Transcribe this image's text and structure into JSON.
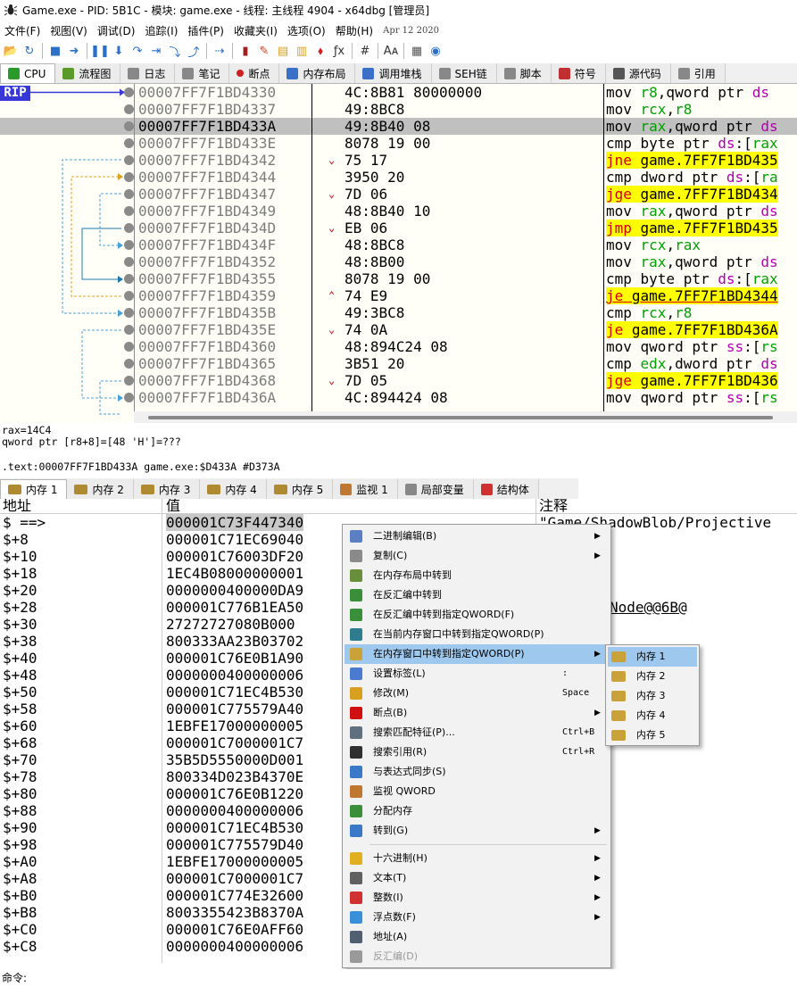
{
  "window": {
    "title": "Game.exe - PID: 5B1C - 模块: game.exe - 线程: 主线程 4904 - x64dbg [管理员]"
  },
  "menu": {
    "items": [
      "文件(F)",
      "视图(V)",
      "调试(D)",
      "追踪(I)",
      "插件(P)",
      "收藏夹(I)",
      "选项(O)",
      "帮助(H)"
    ],
    "date": "Apr 12 2020"
  },
  "toolbar": {
    "icons": [
      "open-icon",
      "restart-icon",
      "stop-icon",
      "run-icon",
      "pause-icon",
      "step-into-icon",
      "step-over-icon",
      "trace-into-icon",
      "trace-over-icon",
      "execute-till-return-icon",
      "run-to-user-code-icon",
      "script-icon",
      "patch-icon",
      "comment-icon",
      "label-icon",
      "bookmark-icon",
      "function-icon",
      "hash-icon",
      "font-icon",
      "calculator-icon",
      "globe-icon"
    ]
  },
  "main_tabs": [
    "CPU",
    "流程图",
    "日志",
    "笔记",
    "断点",
    "内存布局",
    "调用堆栈",
    "SEH链",
    "脚本",
    "符号",
    "源代码",
    "引用"
  ],
  "disasm": {
    "rip_label": "RIP",
    "rows": [
      {
        "addr": "00007FF7F1BD4330",
        "mark": "",
        "bytes": "4C:8B81 80000000",
        "ins": [
          {
            "t": "mov ",
            "c": ""
          },
          {
            "t": "r8",
            "c": "rg"
          },
          {
            "t": ",qword ptr ",
            "c": ""
          },
          {
            "t": "ds",
            "c": "seg"
          }
        ]
      },
      {
        "addr": "00007FF7F1BD4337",
        "mark": "",
        "bytes": "49:8BC8",
        "ins": [
          {
            "t": "mov ",
            "c": ""
          },
          {
            "t": "rcx",
            "c": "rg"
          },
          {
            "t": ",",
            "c": ""
          },
          {
            "t": "r8",
            "c": "rg"
          }
        ]
      },
      {
        "addr": "00007FF7F1BD433A",
        "mark": "",
        "bytes": "49:8B40 08",
        "ins": [
          {
            "t": "mov ",
            "c": ""
          },
          {
            "t": "rax",
            "c": "rg"
          },
          {
            "t": ",qword ptr ",
            "c": ""
          },
          {
            "t": "ds",
            "c": "seg"
          }
        ],
        "selected": true
      },
      {
        "addr": "00007FF7F1BD433E",
        "mark": "",
        "bytes": "8078 19 00",
        "ins": [
          {
            "t": "cmp ",
            "c": ""
          },
          {
            "t": "byte ptr ",
            "c": ""
          },
          {
            "t": "ds",
            "c": "seg"
          },
          {
            "t": ":[",
            "c": ""
          },
          {
            "t": "rax",
            "c": "rg"
          }
        ]
      },
      {
        "addr": "00007FF7F1BD4342",
        "mark": "⌄",
        "bytes": "75 17",
        "ins": [
          {
            "t": "jne",
            "c": "kw-j hl"
          },
          {
            "t": " game.7FF7F1BD435",
            "c": "hl"
          }
        ]
      },
      {
        "addr": "00007FF7F1BD4344",
        "mark": "",
        "bytes": "3950 20",
        "ins": [
          {
            "t": "cmp ",
            "c": ""
          },
          {
            "t": "dword ptr ",
            "c": ""
          },
          {
            "t": "ds",
            "c": "seg"
          },
          {
            "t": ":[",
            "c": ""
          },
          {
            "t": "ra",
            "c": "rg"
          }
        ]
      },
      {
        "addr": "00007FF7F1BD4347",
        "mark": "⌄",
        "bytes": "7D 06",
        "ins": [
          {
            "t": "jge",
            "c": "kw-j hl"
          },
          {
            "t": " game.7FF7F1BD434",
            "c": "hl"
          }
        ]
      },
      {
        "addr": "00007FF7F1BD4349",
        "mark": "",
        "bytes": "48:8B40 10",
        "ins": [
          {
            "t": "mov ",
            "c": ""
          },
          {
            "t": "rax",
            "c": "rg"
          },
          {
            "t": ",qword ptr ",
            "c": ""
          },
          {
            "t": "ds",
            "c": "seg"
          }
        ]
      },
      {
        "addr": "00007FF7F1BD434D",
        "mark": "⌄",
        "bytes": "EB 06",
        "ins": [
          {
            "t": "jmp",
            "c": "kw-j hl"
          },
          {
            "t": " game.7FF7F1BD435",
            "c": "hl"
          }
        ]
      },
      {
        "addr": "00007FF7F1BD434F",
        "mark": "",
        "bytes": "48:8BC8",
        "ins": [
          {
            "t": "mov ",
            "c": ""
          },
          {
            "t": "rcx",
            "c": "rg"
          },
          {
            "t": ",",
            "c": ""
          },
          {
            "t": "rax",
            "c": "rg"
          }
        ]
      },
      {
        "addr": "00007FF7F1BD4352",
        "mark": "",
        "bytes": "48:8B00",
        "ins": [
          {
            "t": "mov ",
            "c": ""
          },
          {
            "t": "rax",
            "c": "rg"
          },
          {
            "t": ",qword ptr ",
            "c": ""
          },
          {
            "t": "ds",
            "c": "seg"
          }
        ]
      },
      {
        "addr": "00007FF7F1BD4355",
        "mark": "",
        "bytes": "8078 19 00",
        "ins": [
          {
            "t": "cmp ",
            "c": ""
          },
          {
            "t": "byte ptr ",
            "c": ""
          },
          {
            "t": "ds",
            "c": "seg"
          },
          {
            "t": ":[",
            "c": ""
          },
          {
            "t": "rax",
            "c": "rg"
          }
        ]
      },
      {
        "addr": "00007FF7F1BD4359",
        "mark": "⌃",
        "bytes": "74 E9",
        "ins": [
          {
            "t": "je",
            "c": "kw-j hl"
          },
          {
            "t": " game.7FF7F1BD4344",
            "c": "hl"
          }
        ]
      },
      {
        "addr": "00007FF7F1BD435B",
        "mark": "",
        "bytes": "49:3BC8",
        "ins": [
          {
            "t": "cmp ",
            "c": ""
          },
          {
            "t": "rcx",
            "c": "rg"
          },
          {
            "t": ",",
            "c": ""
          },
          {
            "t": "r8",
            "c": "rg"
          }
        ]
      },
      {
        "addr": "00007FF7F1BD435E",
        "mark": "⌄",
        "bytes": "74 0A",
        "ins": [
          {
            "t": "je",
            "c": "kw-j hl"
          },
          {
            "t": " game.7FF7F1BD436A",
            "c": "hl"
          }
        ]
      },
      {
        "addr": "00007FF7F1BD4360",
        "mark": "",
        "bytes": "48:894C24 08",
        "ins": [
          {
            "t": "mov ",
            "c": ""
          },
          {
            "t": "qword ptr ",
            "c": ""
          },
          {
            "t": "ss",
            "c": "seg"
          },
          {
            "t": ":[",
            "c": ""
          },
          {
            "t": "rs",
            "c": "rg"
          }
        ]
      },
      {
        "addr": "00007FF7F1BD4365",
        "mark": "",
        "bytes": "3B51 20",
        "ins": [
          {
            "t": "cmp ",
            "c": ""
          },
          {
            "t": "edx",
            "c": "rg"
          },
          {
            "t": ",dword ptr ",
            "c": ""
          },
          {
            "t": "ds",
            "c": "seg"
          }
        ]
      },
      {
        "addr": "00007FF7F1BD4368",
        "mark": "⌄",
        "bytes": "7D 05",
        "ins": [
          {
            "t": "jge",
            "c": "kw-j hl"
          },
          {
            "t": " game.7FF7F1BD436",
            "c": "hl"
          }
        ]
      },
      {
        "addr": "00007FF7F1BD436A",
        "mark": "",
        "bytes": "4C:894424 08",
        "ins": [
          {
            "t": "mov ",
            "c": ""
          },
          {
            "t": "qword ptr ",
            "c": ""
          },
          {
            "t": "ss",
            "c": "seg"
          },
          {
            "t": ":[",
            "c": ""
          },
          {
            "t": "rs",
            "c": "rg"
          }
        ]
      }
    ]
  },
  "info": {
    "line1": "rax=14C4",
    "line2": "qword ptr [r8+8]=[48 'H']=???",
    "line3": ".text:00007FF7F1BD433A game.exe:$D433A #D373A"
  },
  "dump_tabs": [
    "内存 1",
    "内存 2",
    "内存 3",
    "内存 4",
    "内存 5",
    "监视 1",
    "局部变量",
    "结构体"
  ],
  "dump": {
    "headers": {
      "addr": "地址",
      "value": "值",
      "comment": "注释"
    },
    "rows": [
      {
        "off": "$ ==>",
        "val": "000001C73F447340",
        "cmt": "\"Game/ShadowBlob/Projective"
      },
      {
        "off": "$+8",
        "val": "000001C71EC69040",
        "cmt": ""
      },
      {
        "off": "$+10",
        "val": "000001C76003DF20",
        "cmt": ""
      },
      {
        "off": "$+18",
        "val": "1EC4B08000000001",
        "cmt": ""
      },
      {
        "off": "$+20",
        "val": "0000000400000DA9",
        "cmt": ""
      },
      {
        "off": "$+28",
        "val": "000001C776B1EA50",
        "cmt": "Node@@6B@"
      },
      {
        "off": "$+30",
        "val": "27272727080B000",
        "cmt": ""
      },
      {
        "off": "$+38",
        "val": "800333AA23B03702",
        "cmt": ""
      },
      {
        "off": "$+40",
        "val": "000001C76E0B1A90",
        "cmt": ""
      },
      {
        "off": "$+48",
        "val": "0000000400000006",
        "cmt": ""
      },
      {
        "off": "$+50",
        "val": "000001C71EC4B530",
        "cmt": ""
      },
      {
        "off": "$+58",
        "val": "000001C775579A40",
        "cmt": ""
      },
      {
        "off": "$+60",
        "val": "1EBFE17000000005",
        "cmt": ""
      },
      {
        "off": "$+68",
        "val": "000001C7000001C7",
        "cmt": ""
      },
      {
        "off": "$+70",
        "val": "35B5D5550000D001",
        "cmt": ""
      },
      {
        "off": "$+78",
        "val": "800334D023B4370E",
        "cmt": ""
      },
      {
        "off": "$+80",
        "val": "000001C76E0B1220",
        "cmt": ""
      },
      {
        "off": "$+88",
        "val": "0000000400000006",
        "cmt": ""
      },
      {
        "off": "$+90",
        "val": "000001C71EC4B530",
        "cmt": ""
      },
      {
        "off": "$+98",
        "val": "000001C775579D40",
        "cmt": ""
      },
      {
        "off": "$+A0",
        "val": "1EBFE17000000005",
        "cmt": ""
      },
      {
        "off": "$+A8",
        "val": "000001C7000001C7",
        "cmt": ""
      },
      {
        "off": "$+B0",
        "val": "000001C774E32600",
        "cmt": ""
      },
      {
        "off": "$+B8",
        "val": "8003355423B8370A",
        "cmt": ""
      },
      {
        "off": "$+C0",
        "val": "000001C76E0AFF60",
        "cmt": ""
      },
      {
        "off": "$+C8",
        "val": "0000000400000006",
        "cmt": ""
      }
    ]
  },
  "context_menu": {
    "items": [
      {
        "label": "二进制编辑(B)",
        "shortcut": "",
        "arrow": true,
        "icon": "binary-edit-icon",
        "color": "#5b7fc2"
      },
      {
        "label": "复制(C)",
        "shortcut": "",
        "arrow": true,
        "icon": "copy-icon",
        "color": "#8a8a8a"
      },
      {
        "label": "在内存布局中转到",
        "shortcut": "",
        "arrow": false,
        "icon": "memory-map-icon",
        "color": "#6a8f3a"
      },
      {
        "label": "在反汇编中转到",
        "shortcut": "",
        "arrow": false,
        "icon": "disassembly-icon",
        "color": "#3a8f3a"
      },
      {
        "label": "在反汇编中转到指定QWORD(F)",
        "shortcut": "",
        "arrow": false,
        "icon": "disassembly-qword-icon",
        "color": "#3a8f3a"
      },
      {
        "label": "在当前内存窗口中转到指定QWORD(P)",
        "shortcut": "",
        "arrow": false,
        "icon": "dump-qword-icon",
        "color": "#2e7d8f"
      },
      {
        "label": "在内存窗口中转到指定QWORD(P)",
        "shortcut": "",
        "arrow": true,
        "icon": "dump-window-qword-icon",
        "color": "#c9a23a",
        "highlight": true
      },
      {
        "label": "设置标签(L)",
        "shortcut": ":",
        "arrow": false,
        "icon": "label-icon",
        "color": "#4a7bd0"
      },
      {
        "label": "修改(M)",
        "shortcut": "Space",
        "arrow": false,
        "icon": "pencil-icon",
        "color": "#d8a020"
      },
      {
        "label": "断点(B)",
        "shortcut": "",
        "arrow": true,
        "icon": "breakpoint-icon",
        "color": "#d01010"
      },
      {
        "label": "搜索匹配特征(P)...",
        "shortcut": "Ctrl+B",
        "arrow": false,
        "icon": "search-pattern-icon",
        "color": "#607080"
      },
      {
        "label": "搜索引用(R)",
        "shortcut": "Ctrl+R",
        "arrow": false,
        "icon": "binoculars-icon",
        "color": "#303030"
      },
      {
        "label": "与表达式同步(S)",
        "shortcut": "",
        "arrow": false,
        "icon": "sync-icon",
        "color": "#3a78c8"
      },
      {
        "label": "监视 QWORD",
        "shortcut": "",
        "arrow": false,
        "icon": "watch-icon",
        "color": "#c07830"
      },
      {
        "label": "分配内存",
        "shortcut": "",
        "arrow": false,
        "icon": "allocate-memory-icon",
        "color": "#3a8f3a"
      },
      {
        "label": "转到(G)",
        "shortcut": "",
        "arrow": true,
        "icon": "goto-icon",
        "color": "#3a78c8"
      },
      {
        "label": "十六进制(H)",
        "shortcut": "",
        "arrow": true,
        "icon": "hex-icon",
        "color": "#e0b020",
        "sep_before": true
      },
      {
        "label": "文本(T)",
        "shortcut": "",
        "arrow": true,
        "icon": "text-icon",
        "color": "#606060"
      },
      {
        "label": "整数(I)",
        "shortcut": "",
        "arrow": true,
        "icon": "integer-icon",
        "color": "#d03030"
      },
      {
        "label": "浮点数(F)",
        "shortcut": "",
        "arrow": true,
        "icon": "float-icon",
        "color": "#3a90d8"
      },
      {
        "label": "地址(A)",
        "shortcut": "",
        "arrow": false,
        "icon": "address-icon",
        "color": "#506070"
      },
      {
        "label": "反汇编(D)",
        "shortcut": "",
        "arrow": false,
        "icon": "disassembly-view-icon",
        "color": "#9a9a9a",
        "disabled": true
      }
    ]
  },
  "submenu": {
    "items": [
      "内存 1",
      "内存 2",
      "内存 3",
      "内存 4",
      "内存 5"
    ]
  },
  "command": {
    "label": "命令:"
  }
}
